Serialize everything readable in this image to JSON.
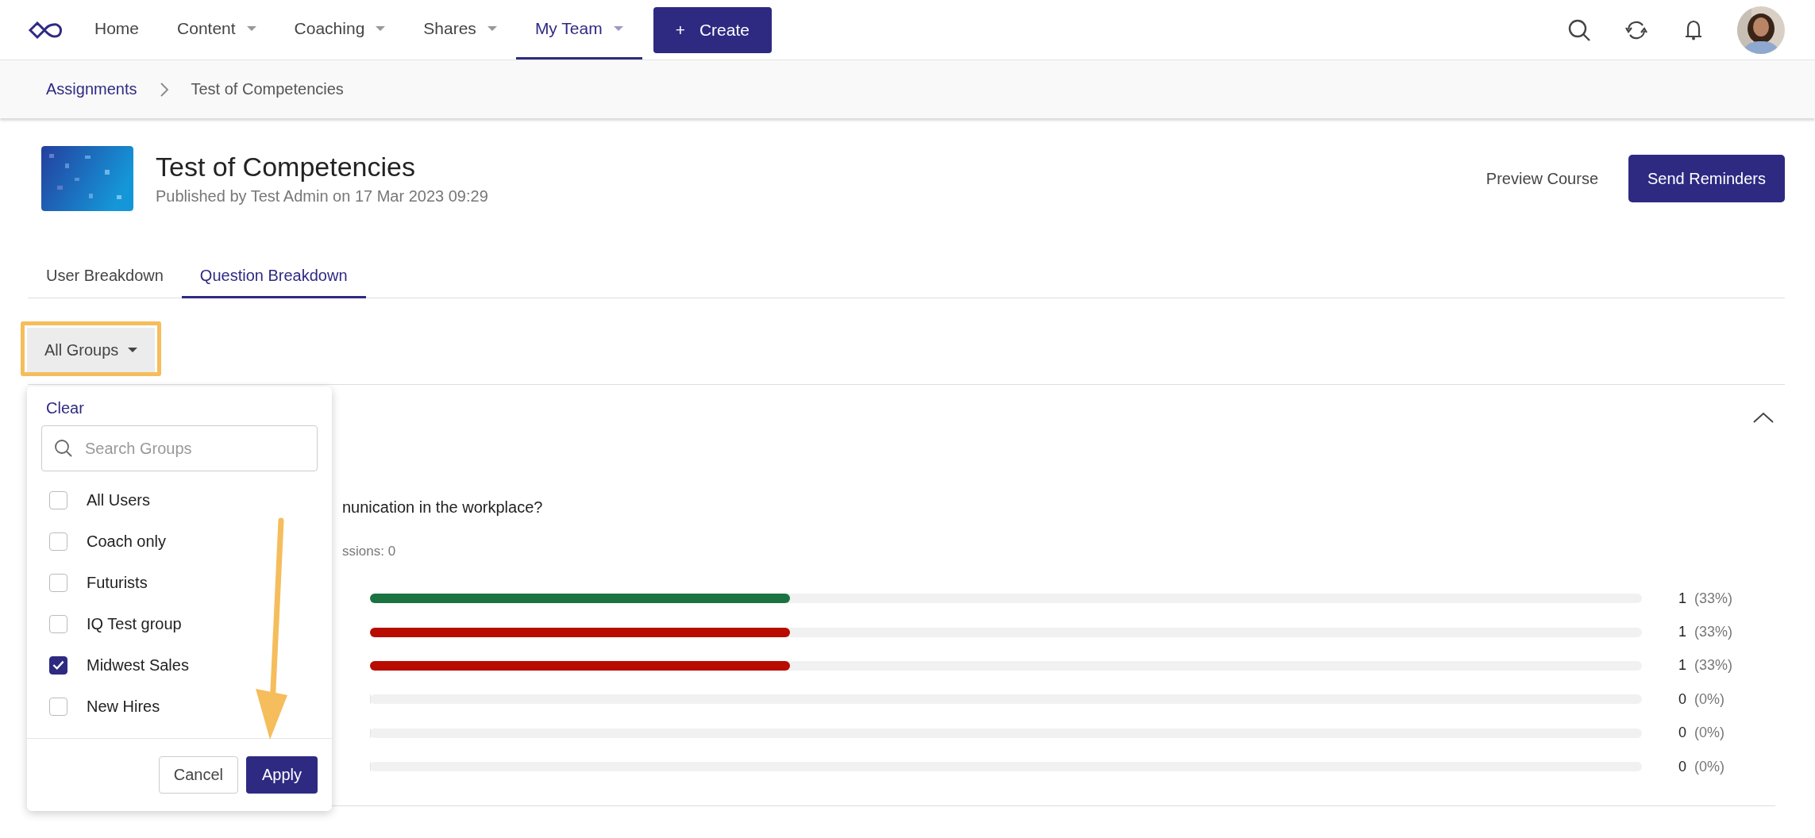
{
  "nav": {
    "items": [
      {
        "label": "Home",
        "dropdown": false,
        "selected": false
      },
      {
        "label": "Content",
        "dropdown": true,
        "selected": false
      },
      {
        "label": "Coaching",
        "dropdown": true,
        "selected": false
      },
      {
        "label": "Shares",
        "dropdown": true,
        "selected": false
      },
      {
        "label": "My Team",
        "dropdown": true,
        "selected": true
      }
    ],
    "create_button": {
      "icon": "+",
      "label": "Create"
    }
  },
  "breadcrumb": [
    {
      "label": "Assignments",
      "kind": "link"
    },
    {
      "label": "Test of Competencies",
      "kind": "current"
    }
  ],
  "header": {
    "title": "Test of Competencies",
    "subtitle": "Published by Test Admin on 17 Mar 2023 09:29",
    "preview_link": "Preview Course",
    "send_button": "Send Reminders"
  },
  "tabs": [
    {
      "label": "User Breakdown",
      "selected": false
    },
    {
      "label": "Question Breakdown",
      "selected": true
    }
  ],
  "group_filter": {
    "label": "All Groups"
  },
  "dropdown": {
    "clear": "Clear",
    "search": {
      "placeholder": "Search Groups"
    },
    "options": [
      {
        "label": "All Users",
        "checked": false
      },
      {
        "label": "Coach only",
        "checked": false
      },
      {
        "label": "Futurists",
        "checked": false
      },
      {
        "label": "IQ Test group",
        "checked": false
      },
      {
        "label": "Midwest Sales",
        "checked": true
      },
      {
        "label": "New Hires",
        "checked": false
      }
    ],
    "cancel": "Cancel",
    "apply": "Apply"
  },
  "question": {
    "expanded": true,
    "text": "nunication in the workplace?",
    "meta": "ssions: 0",
    "answers": [
      {
        "level": 0.33,
        "color": "#1a7340",
        "count": "1",
        "percent": "(33%)"
      },
      {
        "level": 0.33,
        "color": "#b80c00",
        "count": "1",
        "percent": "(33%)"
      },
      {
        "level": 0.33,
        "color": "#b80c00",
        "count": "1",
        "percent": "(33%)"
      },
      {
        "level": 0,
        "count": "0",
        "percent": "(0%)"
      },
      {
        "level": 0,
        "count": "0",
        "percent": "(0%)"
      },
      {
        "level": 0,
        "count": "0",
        "percent": "(0%)"
      }
    ]
  }
}
